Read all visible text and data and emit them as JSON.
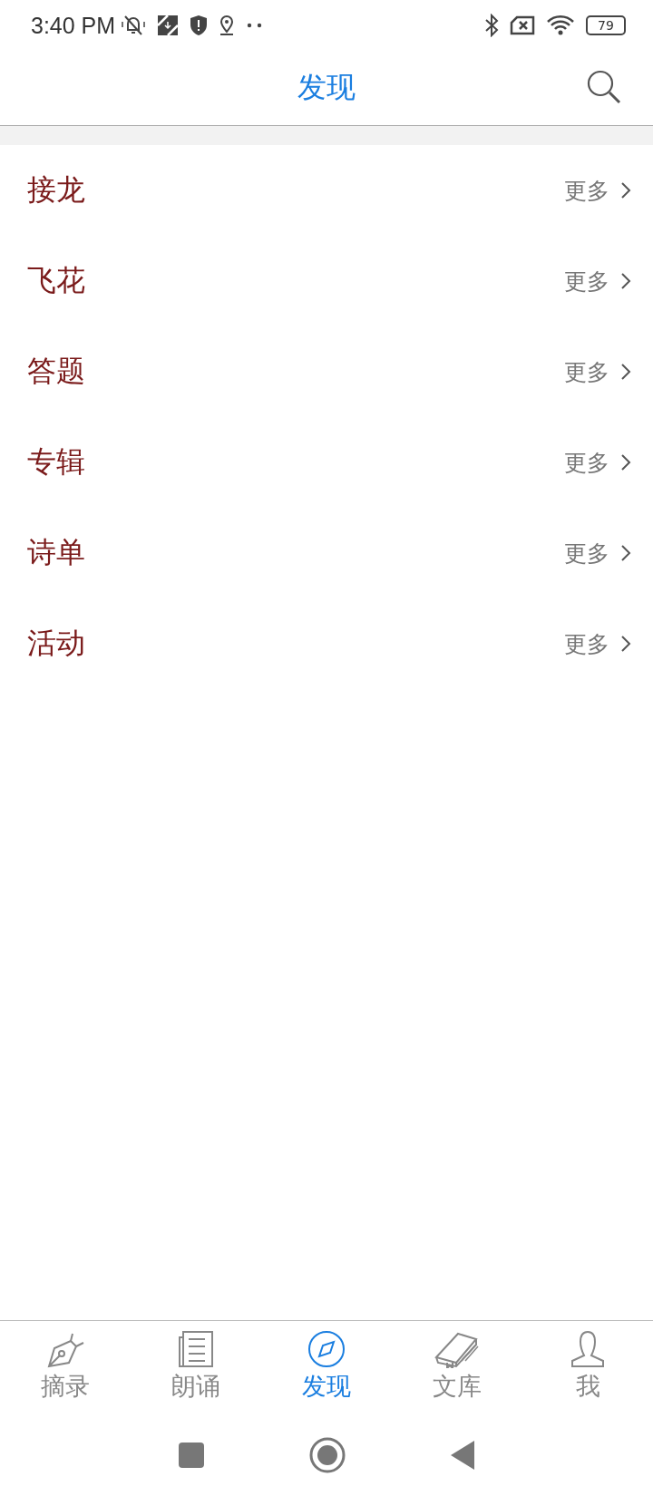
{
  "status_bar": {
    "time": "3:40 PM",
    "battery": "79"
  },
  "header": {
    "title": "发现"
  },
  "sections": [
    {
      "label": "接龙",
      "more": "更多"
    },
    {
      "label": "飞花",
      "more": "更多"
    },
    {
      "label": "答题",
      "more": "更多"
    },
    {
      "label": "专辑",
      "more": "更多"
    },
    {
      "label": "诗单",
      "more": "更多"
    },
    {
      "label": "活动",
      "more": "更多"
    }
  ],
  "tabs": [
    {
      "label": "摘录",
      "kind": "pen",
      "selected": false
    },
    {
      "label": "朗诵",
      "kind": "paper",
      "selected": false
    },
    {
      "label": "发现",
      "kind": "compass",
      "selected": true
    },
    {
      "label": "文库",
      "kind": "book",
      "selected": false
    },
    {
      "label": "我",
      "kind": "person",
      "selected": false
    }
  ]
}
